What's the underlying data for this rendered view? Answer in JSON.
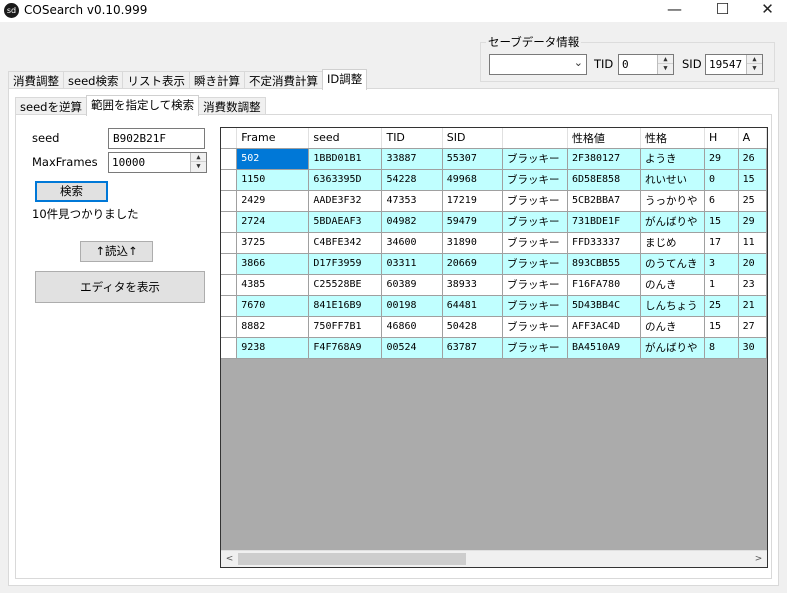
{
  "window": {
    "title": "COSearch v0.10.999",
    "icon_glyph": "sd",
    "minimize": "—",
    "maximize": "☐",
    "close": "✕"
  },
  "save_info": {
    "title": "セーブデータ情報",
    "combo_value": "",
    "tid_label": "TID",
    "tid_value": "0",
    "sid_label": "SID",
    "sid_value": "19547"
  },
  "main_tabs": [
    "消費調整",
    "seed検索",
    "リスト表示",
    "瞬き計算",
    "不定消費計算",
    "ID調整"
  ],
  "sub_tabs": [
    "seedを逆算",
    "範囲を指定して検索",
    "消費数調整"
  ],
  "form": {
    "seed_label": "seed",
    "seed_value": "B902B21F",
    "maxframes_label": "MaxFrames",
    "maxframes_value": "10000",
    "search_button": "検索",
    "result_text": "10件見つかりました",
    "load_button": "↑読込↑",
    "editor_button": "エディタを表示"
  },
  "grid": {
    "columns": [
      "Frame",
      "seed",
      "TID",
      "SID",
      "",
      "性格値",
      "性格",
      "H",
      "A"
    ],
    "rows": [
      [
        "502",
        "1BBD01B1",
        "33887",
        "55307",
        "ブラッキー",
        "2F380127",
        "ようき",
        "29",
        "26"
      ],
      [
        "1150",
        "6363395D",
        "54228",
        "49968",
        "ブラッキー",
        "6D58E858",
        "れいせい",
        "0",
        "15"
      ],
      [
        "2429",
        "AADE3F32",
        "47353",
        "17219",
        "ブラッキー",
        "5CB2BBA7",
        "うっかりや",
        "6",
        "25"
      ],
      [
        "2724",
        "5BDAEAF3",
        "04982",
        "59479",
        "ブラッキー",
        "731BDE1F",
        "がんばりや",
        "15",
        "29"
      ],
      [
        "3725",
        "C4BFE342",
        "34600",
        "31890",
        "ブラッキー",
        "FFD33337",
        "まじめ",
        "17",
        "11"
      ],
      [
        "3866",
        "D17F3959",
        "03311",
        "20669",
        "ブラッキー",
        "893CBB55",
        "のうてんき",
        "3",
        "20"
      ],
      [
        "4385",
        "C25528BE",
        "60389",
        "38933",
        "ブラッキー",
        "F16FA780",
        "のんき",
        "1",
        "23"
      ],
      [
        "7670",
        "841E16B9",
        "00198",
        "64481",
        "ブラッキー",
        "5D43BB4C",
        "しんちょう",
        "25",
        "21"
      ],
      [
        "8882",
        "750FF7B1",
        "46860",
        "50428",
        "ブラッキー",
        "AFF3AC4D",
        "のんき",
        "15",
        "27"
      ],
      [
        "9238",
        "F4F768A9",
        "00524",
        "63787",
        "ブラッキー",
        "BA4510A9",
        "がんばりや",
        "8",
        "30"
      ]
    ]
  },
  "icons": {
    "combo_arrow": "chevron-down-icon",
    "spin_up": "▲",
    "spin_down": "▼",
    "scroll_left": "<",
    "scroll_right": ">"
  },
  "colors": {
    "alt_row": "#c0ffff",
    "selection": "#0078d7"
  }
}
